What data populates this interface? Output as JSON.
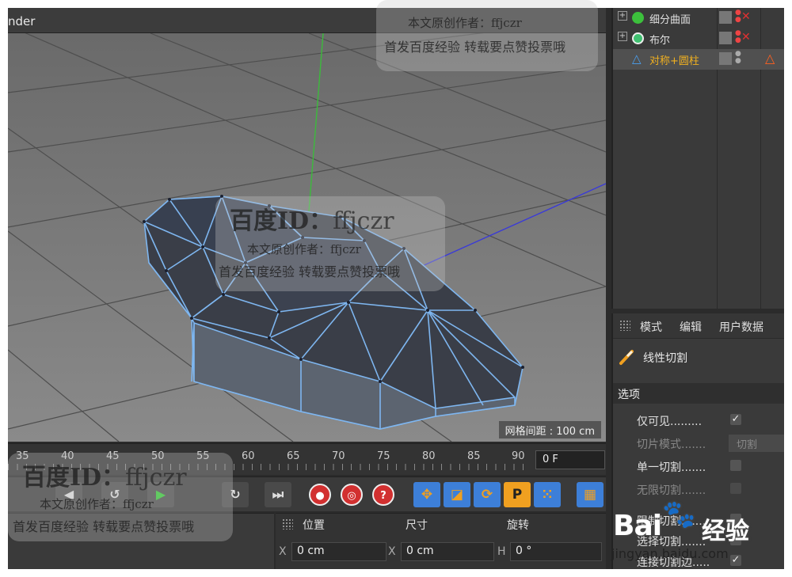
{
  "viewport": {
    "title_fragment": "nder",
    "grid_spacing": "网格间距 : 100 cm"
  },
  "object_manager": {
    "objects": [
      {
        "name": "细分曲面",
        "icon_color": "#3cc03c"
      },
      {
        "name": "布尔",
        "icon_color": "#40c070"
      },
      {
        "name": "对称+圆柱",
        "icon_color": "#4aa0f0",
        "selected": true,
        "warning": true
      }
    ]
  },
  "attributes": {
    "menu": [
      "模式",
      "编辑",
      "用户数据"
    ],
    "tool_name": "线性切割",
    "section": "选项",
    "options": [
      {
        "label": "仅可见.........",
        "type": "checkbox",
        "checked": true
      },
      {
        "label": "切片模式.......",
        "type": "dropdown",
        "value": "切割",
        "disabled": true
      },
      {
        "label": "单一切割.......",
        "type": "checkbox",
        "checked": false
      },
      {
        "label": "无限切割.......",
        "type": "checkbox",
        "checked": false,
        "disabled": true
      },
      {
        "label": "限制切割.......",
        "type": "checkbox",
        "checked": false
      },
      {
        "label": "选择切割.......",
        "type": "checkbox",
        "checked": false
      },
      {
        "label": "连接切割边.....",
        "type": "checkbox",
        "checked": true
      }
    ]
  },
  "timeline": {
    "labels": [
      "35",
      "40",
      "45",
      "50",
      "55",
      "60",
      "65",
      "70",
      "75",
      "80",
      "85",
      "90"
    ],
    "current_frame": "0 F"
  },
  "coordinates": {
    "headers": [
      "位置",
      "尺寸",
      "旋转"
    ],
    "fields": [
      {
        "axis": "X",
        "value": "0 cm"
      },
      {
        "axis": "X",
        "value": "0 cm"
      },
      {
        "axis": "H",
        "value": "0 °"
      }
    ]
  },
  "watermark": {
    "id_line_cn": "百度ID：",
    "id_line_en": "ffjczr",
    "author_line": "本文原创作者：ffjczr",
    "notice_line": "首发百度经验 转载要点赞投票哦"
  },
  "baidu_logo": {
    "text": "Bai",
    "cn": "经验",
    "url": "jingyan.baidu.com"
  }
}
